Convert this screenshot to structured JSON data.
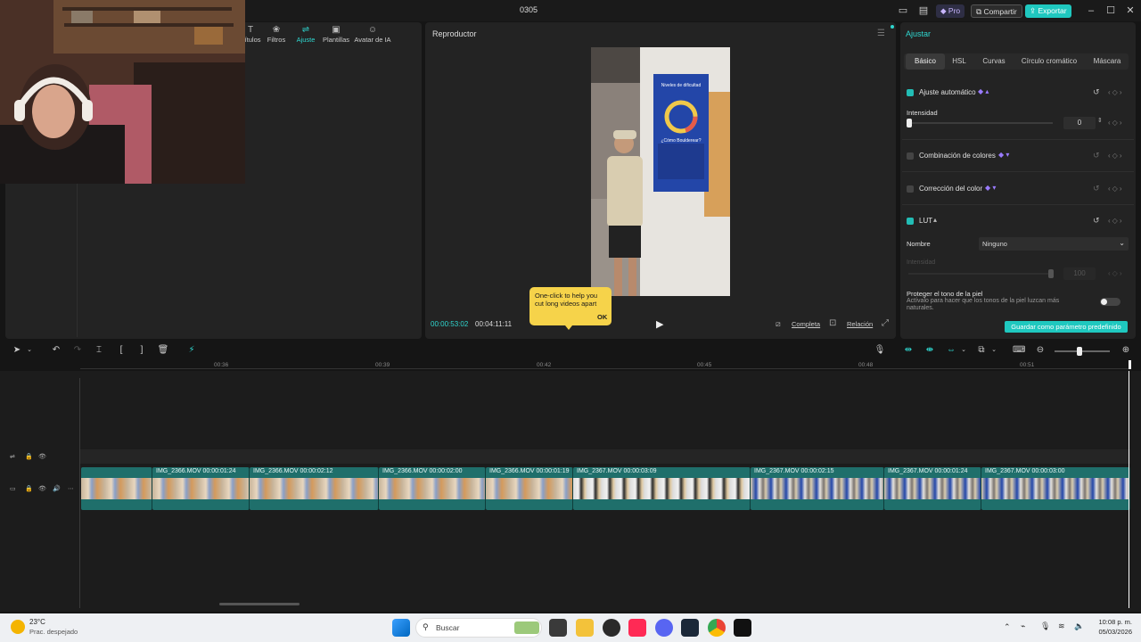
{
  "window": {
    "title": "0305",
    "pro_label": "Pro",
    "share_label": "Compartir",
    "export_label": "Exportar"
  },
  "left_tabs": [
    {
      "label": "Títulos",
      "icon": "title-icon"
    },
    {
      "label": "Filtros",
      "icon": "filter-icon"
    },
    {
      "label": "Ajuste",
      "icon": "adjust-icon",
      "active": true
    },
    {
      "label": "Plantillas",
      "icon": "template-icon"
    },
    {
      "label": "Avatar de IA",
      "icon": "avatar-icon"
    }
  ],
  "player": {
    "title": "Reproductor",
    "current_time": "00:00:53:02",
    "total_time": "00:04:11:11",
    "full_label": "Completa",
    "ratio_label": "Relación",
    "tooltip": {
      "text": "One-click to help you cut long videos apart",
      "ok": "OK"
    },
    "poster_title": "Niveles de dificultad",
    "poster_sub": "¿Cómo Boulderear?"
  },
  "adjust": {
    "title": "Ajustar",
    "tabs": [
      "Básico",
      "HSL",
      "Curvas",
      "Círculo cromático",
      "Máscara"
    ],
    "auto_adjust": {
      "label": "Ajuste automático",
      "checked": true,
      "intensity_label": "Intensidad",
      "intensity_value": "0"
    },
    "color_match": {
      "label": "Combinación de colores",
      "checked": false
    },
    "color_correction": {
      "label": "Corrección del color",
      "checked": false
    },
    "lut": {
      "label": "LUT",
      "checked": true,
      "name_label": "Nombre",
      "name_value": "Ninguno",
      "intensity_label": "Intensidad",
      "intensity_value": "100"
    },
    "skin_tone": {
      "label": "Proteger el tono de la piel",
      "desc": "Actívalo para hacer que los tonos de la piel luzcan más naturales."
    },
    "save_preset": "Guardar como parámetro predefinido"
  },
  "timeline": {
    "ruler": [
      "00:36",
      "00:39",
      "00:42",
      "00:45",
      "00:48",
      "00:51"
    ],
    "clips": [
      {
        "label": "",
        "scene": "warm"
      },
      {
        "label": "IMG_2366.MOV   00:00:01:24",
        "scene": "warm"
      },
      {
        "label": "IMG_2366.MOV   00:00:02:12",
        "scene": "warm"
      },
      {
        "label": "IMG_2366.MOV   00:00:02:00",
        "scene": "warm"
      },
      {
        "label": "IMG_2366.MOV   00:00:01:19",
        "scene": "warm"
      },
      {
        "label": "IMG_2367.MOV   00:00:03:09",
        "scene": "gym"
      },
      {
        "label": "IMG_2367.MOV   00:00:02:15",
        "scene": "gym"
      },
      {
        "label": "IMG_2367.MOV   00:00:01:24",
        "scene": "gym"
      },
      {
        "label": "IMG_2367.MOV   00:00:03:00",
        "scene": "gym"
      }
    ]
  },
  "taskbar": {
    "weather_temp": "23°C",
    "weather_desc": "Prac. despejado",
    "search_placeholder": "Buscar",
    "time": "10:08 p. m.",
    "date": "05/03/2026"
  }
}
